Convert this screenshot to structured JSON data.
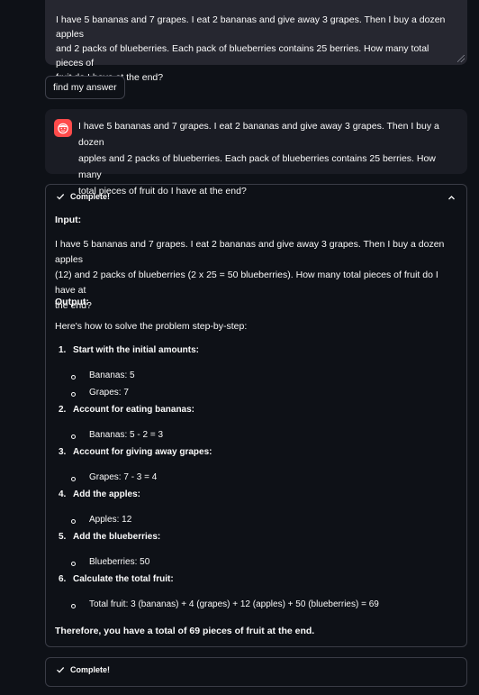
{
  "prompt_input": {
    "value": "I have 5 bananas and 7 grapes. I eat 2 bananas and give away 3 grapes. Then I buy a dozen apples and 2 packs of blueberries. Each pack of blueberries contains 25 berries. How many total pieces of fruit do I have at the end?",
    "line1": "I have 5 bananas and 7 grapes. I eat 2 bananas and give away 3 grapes. Then I buy a dozen apples",
    "line2": "and 2 packs of blueberries. Each pack of blueberries contains 25 berries. How many total pieces of",
    "line3": "fruit do I have at the end?"
  },
  "submit_button": {
    "label": "find my answer"
  },
  "chat_message": {
    "line1": "I have 5 bananas and 7 grapes. I eat 2 bananas and give away 3 grapes. Then I buy a dozen",
    "line2": "apples and 2 packs of blueberries. Each pack of blueberries contains 25 berries. How many",
    "line3": "total pieces of fruit do I have at the end?"
  },
  "status": {
    "label": "Complete!",
    "input_heading": "Input:",
    "input_line1": "I have 5 bananas and 7 grapes. I eat 2 bananas and give away 3 grapes. Then I buy a dozen apples",
    "input_line2": "(12) and 2 packs of blueberries (2 x 25 = 50 blueberries). How many total pieces of fruit do I have at",
    "input_line3": "the end?",
    "output_heading": "Output:",
    "intro": "Here's how to solve the problem step-by-step:",
    "steps": [
      {
        "num": "1.",
        "title": "Start with the initial amounts:",
        "bullets": [
          "Bananas: 5",
          "Grapes: 7"
        ]
      },
      {
        "num": "2.",
        "title": "Account for eating bananas:",
        "bullets": [
          "Bananas: 5 - 2 = 3"
        ]
      },
      {
        "num": "3.",
        "title": "Account for giving away grapes:",
        "bullets": [
          "Grapes: 7 - 3 = 4"
        ]
      },
      {
        "num": "4.",
        "title": "Add the apples:",
        "bullets": [
          "Apples: 12"
        ]
      },
      {
        "num": "5.",
        "title": "Add the blueberries:",
        "bullets": [
          "Blueberries: 50"
        ]
      },
      {
        "num": "6.",
        "title": "Calculate the total fruit:",
        "bullets": [
          "Total fruit: 3 (bananas) + 4 (grapes) + 12 (apples) + 50 (blueberries) = 69"
        ]
      }
    ],
    "conclusion": "Therefore, you have a total of 69 pieces of fruit at the end."
  },
  "status2": {
    "label": "Complete!"
  },
  "colors": {
    "background": "#0e1117",
    "input_bg": "#262730",
    "avatar": "#ff4b4b"
  },
  "icons": {
    "check": "check-icon",
    "chevron": "chevron-up-icon",
    "avatar": "user-avatar-icon"
  }
}
